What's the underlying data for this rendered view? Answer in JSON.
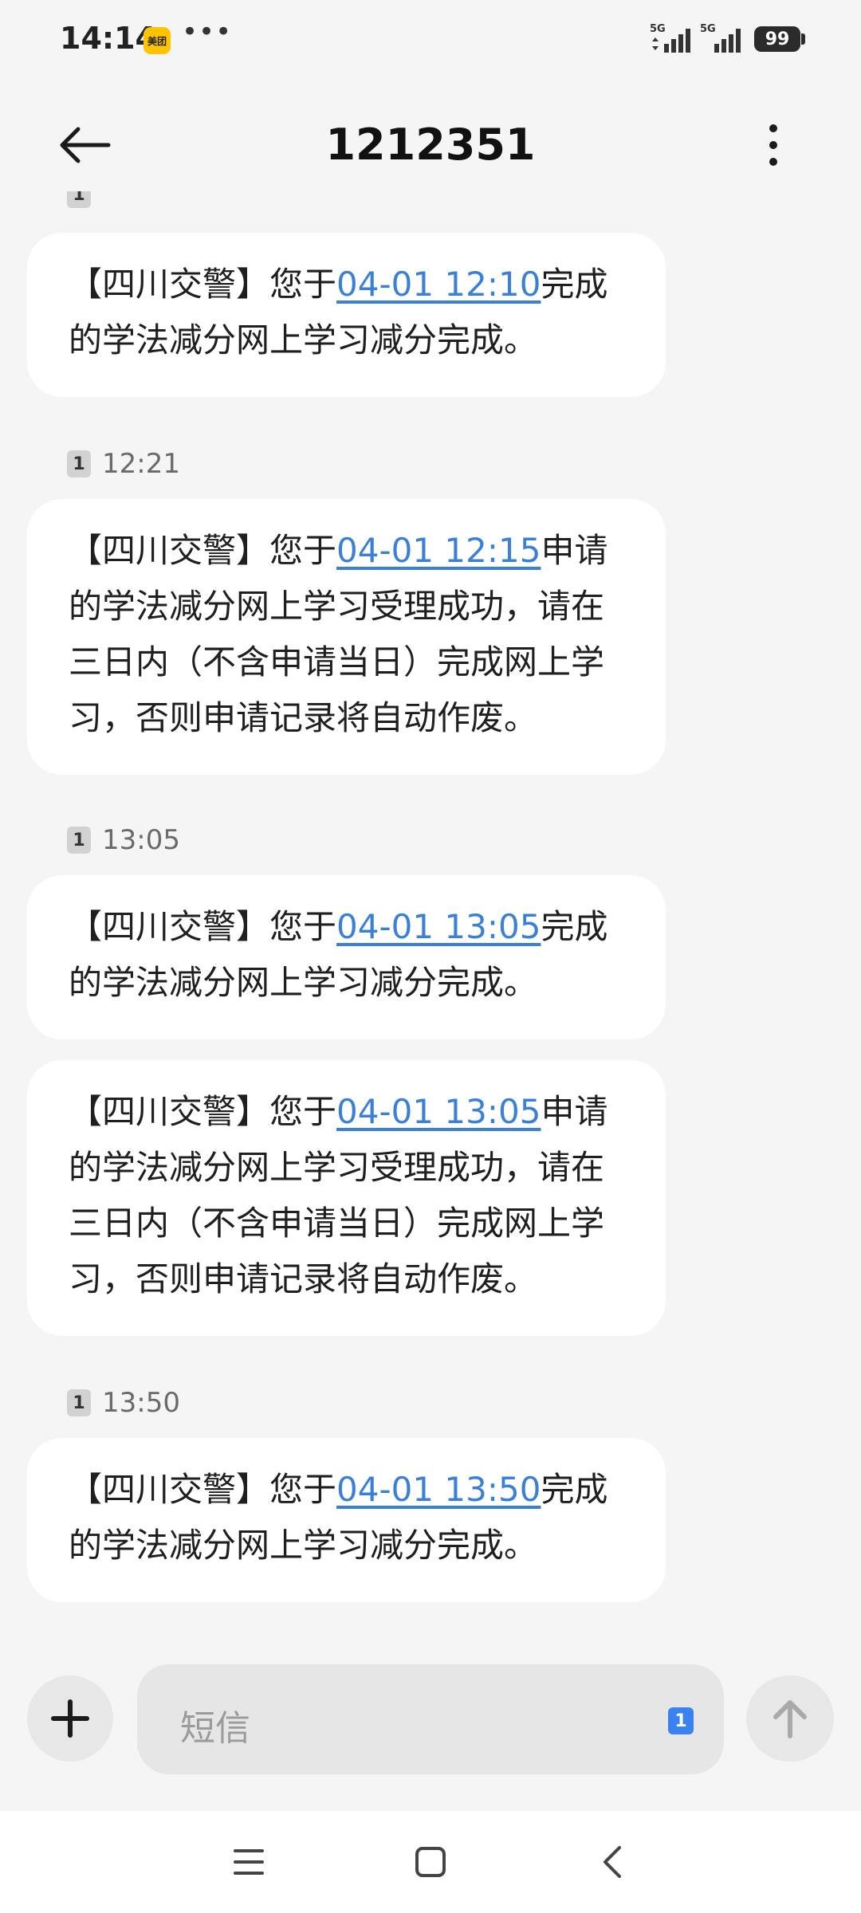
{
  "status_bar": {
    "time": "14:14",
    "app_badge": "美团",
    "more": "•••",
    "battery": "99",
    "network_labels": [
      "5G",
      "5G"
    ]
  },
  "header": {
    "title": "1212351",
    "back_icon": "arrow-left-icon",
    "menu_icon": "more-vertical-icon"
  },
  "sim_label": "1",
  "messages": [
    {
      "timestamp": "",
      "prefix": "【四川交警】您于",
      "link": "04-01 12:10",
      "suffix": "完成的学法减分网上学习减分完成。"
    },
    {
      "timestamp": "12:21",
      "prefix": "【四川交警】您于",
      "link": "04-01 12:15",
      "suffix": "申请的学法减分网上学习受理成功，请在三日内（不含申请当日）完成网上学习，否则申请记录将自动作废。"
    },
    {
      "timestamp": "13:05",
      "prefix": "【四川交警】您于",
      "link": "04-01 13:05",
      "suffix": "完成的学法减分网上学习减分完成。"
    },
    {
      "timestamp": "",
      "prefix": "【四川交警】您于",
      "link": "04-01 13:05",
      "suffix": "申请的学法减分网上学习受理成功，请在三日内（不含申请当日）完成网上学习，否则申请记录将自动作废。"
    },
    {
      "timestamp": "13:50",
      "prefix": "【四川交警】您于",
      "link": "04-01 13:50",
      "suffix": "完成的学法减分网上学习减分完成。"
    }
  ],
  "composer": {
    "placeholder": "短信",
    "sim": "1",
    "plus_icon": "plus-icon",
    "send_icon": "arrow-up-icon"
  },
  "navbar": {
    "icons": [
      "menu-icon",
      "home-square-icon",
      "back-chevron-icon"
    ]
  },
  "colors": {
    "link": "#3a7fd8",
    "background": "#f5f5f5",
    "bubble": "#ffffff",
    "sim_badge": "#3a82f0"
  }
}
